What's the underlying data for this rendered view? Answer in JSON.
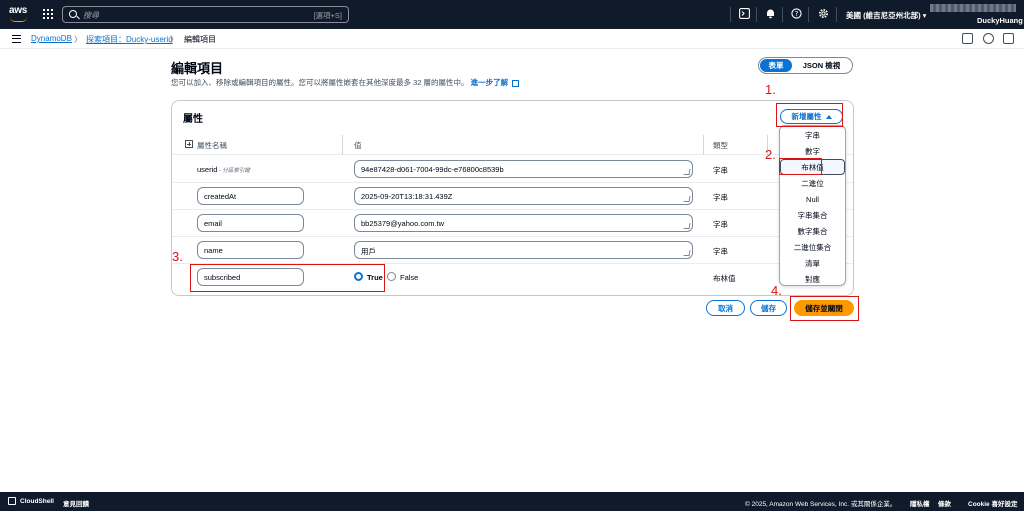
{
  "topnav": {
    "logo_text": "aws",
    "search_placeholder": "搜尋",
    "search_shortcut": "[選項+S]",
    "region": "美國 (維吉尼亞州北部) ▾",
    "user": "DuckyHuang"
  },
  "breadcrumb": {
    "items": [
      "DynamoDB",
      "探索項目：Ducky-userid",
      "編輯項目"
    ],
    "separator": "〉"
  },
  "header": {
    "title": "編輯項目",
    "description": "您可以加入、移除或編輯項目的屬性。您可以將屬性嵌套在其他深度最多 32 層的屬性中。",
    "learn_more": "進一步了解"
  },
  "view_toggle": {
    "form": "表單",
    "json": "JSON 檢視"
  },
  "panel": {
    "title": "屬性",
    "add_button": "新增屬性",
    "columns": {
      "name": "屬性名稱",
      "value": "值",
      "type": "類型"
    },
    "rows": [
      {
        "name": "userid",
        "key_badge": " - 分區索引鍵",
        "value": "94e87428-d061-7004-99dc-e76800c8539b",
        "type": "字串"
      },
      {
        "name": "createdAt",
        "value": "2025-09-20T13:18:31.439Z",
        "type": "字串"
      },
      {
        "name": "email",
        "value": "bb25379@yahoo.com.tw",
        "type": "字串"
      },
      {
        "name": "name",
        "value": "用戶",
        "type": "字串"
      },
      {
        "name": "subscribed",
        "type": "布林值",
        "true_label": "True",
        "false_label": "False",
        "selected": "True"
      }
    ]
  },
  "dropdown": {
    "options": [
      "字串",
      "數字",
      "布林值",
      "二進位",
      "Null",
      "字串集合",
      "數字集合",
      "二進位集合",
      "清單",
      "對應"
    ],
    "highlighted": "布林值"
  },
  "actions": {
    "cancel": "取消",
    "save": "儲存",
    "save_close": "儲存並關閉"
  },
  "annotations": [
    "1.",
    "2.",
    "3.",
    "4."
  ],
  "footer": {
    "cloudshell": "CloudShell",
    "feedback": "意見回饋",
    "copyright": "© 2025, Amazon Web Services, Inc. 或其關係企業。",
    "privacy": "隱私權",
    "terms": "條款",
    "cookie": "Cookie 喜好設定"
  },
  "colors": {
    "nav_bg": "#0f1b2a",
    "link": "#0972d3",
    "primary": "#ff9900",
    "annotation": "#d91515"
  }
}
